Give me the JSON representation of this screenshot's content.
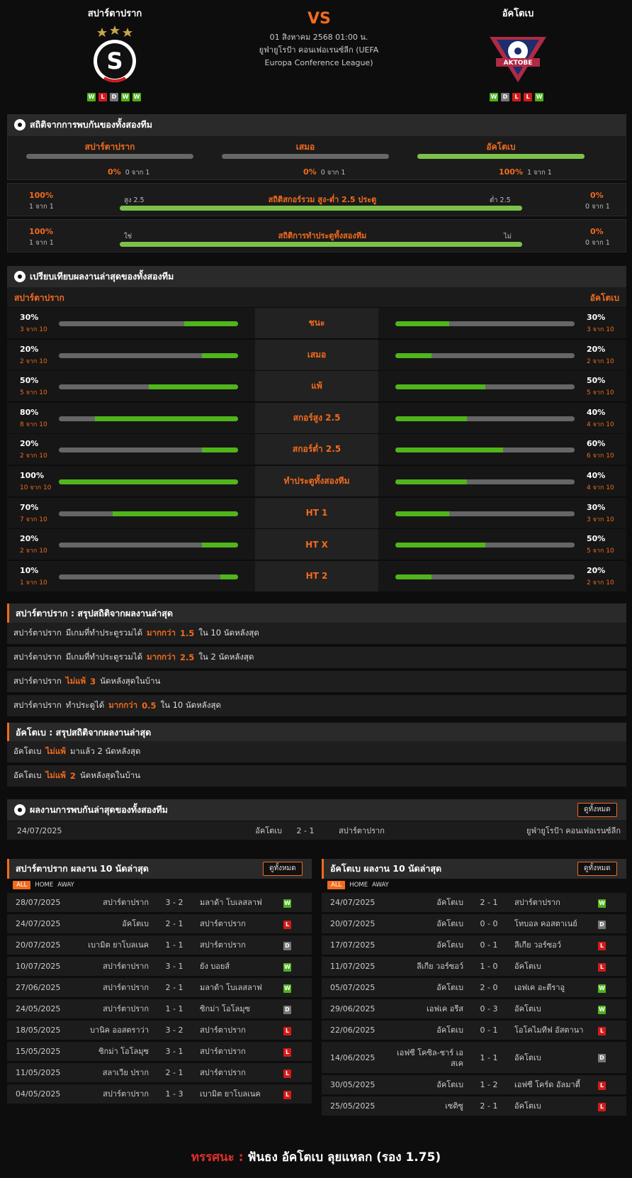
{
  "match": {
    "home": "สปาร์ตาปราก",
    "away": "อัคโตเบ",
    "vs": "VS",
    "datetime": "01 สิงหาคม 2568 01:00 น.",
    "competition": "ยูฟ่ายูโรป้า คอนเฟอเรนซ์ลีก (UEFA Europa Conference League)",
    "home_logo_letter": "S",
    "away_logo_text": "AKTOBE",
    "home_form": [
      "W",
      "L",
      "D",
      "W",
      "W"
    ],
    "away_form": [
      "W",
      "D",
      "L",
      "L",
      "W"
    ]
  },
  "h2h_stats": {
    "title": "สถิติจากการพบกันของทั้งสองทีม",
    "cols": [
      {
        "label": "สปาร์ตาปราก",
        "pct": "0%",
        "sub": "0 จาก 1",
        "fill": 0
      },
      {
        "label": "เสมอ",
        "pct": "0%",
        "sub": "0 จาก 1",
        "fill": 0
      },
      {
        "label": "อัคโตเบ",
        "pct": "100%",
        "sub": "1 จาก 1",
        "fill": 1
      }
    ],
    "ou": {
      "title": "สถิติสกอร์รวม สูง-ต่ำ 2.5 ประตู",
      "left_pct": "100%",
      "left_sub": "1 จาก 1",
      "right_pct": "0%",
      "right_sub": "0 จาก 1",
      "left_label": "สูง 2.5",
      "right_label": "ต่ำ 2.5",
      "fill": 1
    },
    "btts": {
      "title": "สถิติการทำประตูทั้งสองทีม",
      "left_pct": "100%",
      "left_sub": "1 จาก 1",
      "right_pct": "0%",
      "right_sub": "0 จาก 1",
      "left_label": "ใช่",
      "right_label": "ไม่",
      "fill": 1
    }
  },
  "compare": {
    "title": "เปรียบเทียบผลงานล่าสุดของทั้งสองทีม",
    "home": "สปาร์ตาปราก",
    "away": "อัคโตเบ",
    "rows": [
      {
        "label": "ชนะ",
        "h": "30%",
        "hs": "3 จาก 10",
        "hv": 0.3,
        "a": "30%",
        "as": "3 จาก 10",
        "av": 0.3
      },
      {
        "label": "เสมอ",
        "h": "20%",
        "hs": "2 จาก 10",
        "hv": 0.2,
        "a": "20%",
        "as": "2 จาก 10",
        "av": 0.2
      },
      {
        "label": "แพ้",
        "h": "50%",
        "hs": "5 จาก 10",
        "hv": 0.5,
        "a": "50%",
        "as": "5 จาก 10",
        "av": 0.5
      },
      {
        "label": "สกอร์สูง 2.5",
        "h": "80%",
        "hs": "8 จาก 10",
        "hv": 0.8,
        "a": "40%",
        "as": "4 จาก 10",
        "av": 0.4
      },
      {
        "label": "สกอร์ต่ำ 2.5",
        "h": "20%",
        "hs": "2 จาก 10",
        "hv": 0.2,
        "a": "60%",
        "as": "6 จาก 10",
        "av": 0.6
      },
      {
        "label": "ทำประตูทั้งสองทีม",
        "h": "100%",
        "hs": "10 จาก 10",
        "hv": 1.0,
        "a": "40%",
        "as": "4 จาก 10",
        "av": 0.4
      },
      {
        "label": "HT 1",
        "h": "70%",
        "hs": "7 จาก 10",
        "hv": 0.7,
        "a": "30%",
        "as": "3 จาก 10",
        "av": 0.3
      },
      {
        "label": "HT X",
        "h": "20%",
        "hs": "2 จาก 10",
        "hv": 0.2,
        "a": "50%",
        "as": "5 จาก 10",
        "av": 0.5
      },
      {
        "label": "HT 2",
        "h": "10%",
        "hs": "1 จาก 10",
        "hv": 0.1,
        "a": "20%",
        "as": "2 จาก 10",
        "av": 0.2
      }
    ]
  },
  "home_summary": {
    "title": "สปาร์ตาปราก : สรุปสถิติจากผลงานล่าสุด",
    "rows": [
      [
        "สปาร์ตาปราก",
        "มีเกมที่ทำประตูรวมได้",
        "มากกว่า",
        "1.5",
        "ใน 10 นัดหลังสุด"
      ],
      [
        "สปาร์ตาปราก",
        "มีเกมที่ทำประตูรวมได้",
        "มากกว่า",
        "2.5",
        "ใน 2 นัดหลังสุด"
      ],
      [
        "สปาร์ตาปราก",
        "",
        "ไม่แพ้",
        "3",
        "นัดหลังสุดในบ้าน"
      ],
      [
        "สปาร์ตาปราก",
        "ทำประตูได้",
        "มากกว่า",
        "0.5",
        "ใน 10 นัดหลังสุด"
      ]
    ]
  },
  "away_summary": {
    "title": "อัคโตเบ : สรุปสถิติจากผลงานล่าสุด",
    "rows": [
      [
        "อัคโตเบ",
        "",
        "ไม่แพ้",
        "",
        "มาแล้ว 2 นัดหลังสุด"
      ],
      [
        "อัคโตเบ",
        "",
        "ไม่แพ้",
        "2",
        "นัดหลังสุดในบ้าน"
      ]
    ]
  },
  "h2h": {
    "title": "ผลงานการพบกันล่าสุดของทั้งสองทีม",
    "view_all": "ดูทั้งหมด",
    "row": {
      "date": "24/07/2025",
      "home": "อัคโตเบ",
      "score": "2 - 1",
      "away": "สปาร์ตาปราก",
      "comp": "ยูฟ่ายูโรป้า คอนเฟอเรนซ์ลีก"
    }
  },
  "tabs": [
    "ALL",
    "HOME",
    "AWAY"
  ],
  "home_last": {
    "title": "สปาร์ตาปราก ผลงาน 10 นัดล่าสุด",
    "view_all": "ดูทั้งหมด",
    "rows": [
      [
        "28/07/2025",
        "สปาร์ตาปราก",
        "3 - 2",
        "มลาด้า โบเลสลาฟ",
        "W"
      ],
      [
        "24/07/2025",
        "อัคโตเบ",
        "2 - 1",
        "สปาร์ตาปราก",
        "L"
      ],
      [
        "20/07/2025",
        "เบามิต ยาโบลเนค",
        "1 - 1",
        "สปาร์ตาปราก",
        "D"
      ],
      [
        "10/07/2025",
        "สปาร์ตาปราก",
        "3 - 1",
        "ยัง บอยส์",
        "W"
      ],
      [
        "27/06/2025",
        "สปาร์ตาปราก",
        "2 - 1",
        "มลาด้า โบเลสลาฟ",
        "W"
      ],
      [
        "24/05/2025",
        "สปาร์ตาปราก",
        "1 - 1",
        "ซิกม่า โอโลมุซ",
        "D"
      ],
      [
        "18/05/2025",
        "บานิค ออสตราว่า",
        "3 - 2",
        "สปาร์ตาปราก",
        "L"
      ],
      [
        "15/05/2025",
        "ซิกม่า โอโลมุซ",
        "3 - 1",
        "สปาร์ตาปราก",
        "L"
      ],
      [
        "11/05/2025",
        "สลาเวีย ปราก",
        "2 - 1",
        "สปาร์ตาปราก",
        "L"
      ],
      [
        "04/05/2025",
        "สปาร์ตาปราก",
        "1 - 3",
        "เบามิต ยาโบลเนค",
        "L"
      ]
    ]
  },
  "away_last": {
    "title": "อัคโตเบ ผลงาน 10 นัดล่าสุด",
    "view_all": "ดูทั้งหมด",
    "rows": [
      [
        "24/07/2025",
        "อัคโตเบ",
        "2 - 1",
        "สปาร์ตาปราก",
        "W"
      ],
      [
        "20/07/2025",
        "อัคโตเบ",
        "0 - 0",
        "โทบอล คอสตาเนย์",
        "D"
      ],
      [
        "17/07/2025",
        "อัคโตเบ",
        "0 - 1",
        "ลีเกีย วอร์ซอว์",
        "L"
      ],
      [
        "11/07/2025",
        "ลีเกีย วอร์ซอว์",
        "1 - 0",
        "อัคโตเบ",
        "L"
      ],
      [
        "05/07/2025",
        "อัคโตเบ",
        "2 - 0",
        "เอฟเค อะตีราอู",
        "W"
      ],
      [
        "29/06/2025",
        "เอฟเค อรีส",
        "0 - 3",
        "อัคโตเบ",
        "W"
      ],
      [
        "22/06/2025",
        "อัคโตเบ",
        "0 - 1",
        "โอโคไมทีฟ อัสตานา",
        "L"
      ],
      [
        "14/06/2025",
        "เอฟซี โคซิล-ชาร์ เอสเค",
        "1 - 1",
        "อัคโตเบ",
        "D"
      ],
      [
        "30/05/2025",
        "อัคโตเบ",
        "1 - 2",
        "เอฟซี โคร์ด อัลมาตี้",
        "L"
      ],
      [
        "25/05/2025",
        "เซติซู",
        "2 - 1",
        "อัคโตเบ",
        "L"
      ]
    ]
  },
  "prediction": {
    "label": "ทรรศนะ :",
    "text": "ฟันธง อัคโตเบ ลุยแหลก (รอง 1.75)"
  },
  "colors": {
    "accent": "#f26b1d",
    "win": "#4db21b",
    "loss": "#d21b1b",
    "draw": "#777777",
    "bar_fill": "#7cc24a"
  }
}
